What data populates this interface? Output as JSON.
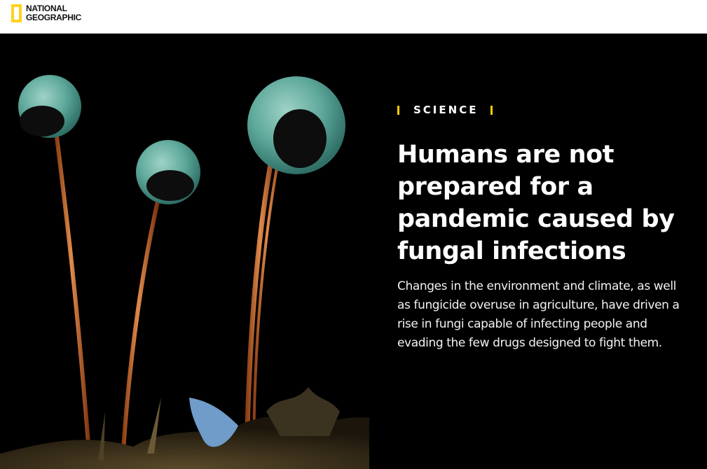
{
  "header": {
    "logo_line1": "NATIONAL",
    "logo_line2": "GEOGRAPHIC",
    "logo_color": "#ffd21e"
  },
  "article": {
    "section": "SCIENCE",
    "headline": "Humans are not prepared for a pandemic caused by fungal infections",
    "dek": "Changes in the environment and climate, as well as fungicide overuse in agriculture, have driven a rise in fungi capable of infecting people and evading the few drugs designed to fight them."
  },
  "colors": {
    "accent": "#ffce00",
    "background": "#000000",
    "text": "#ffffff"
  }
}
